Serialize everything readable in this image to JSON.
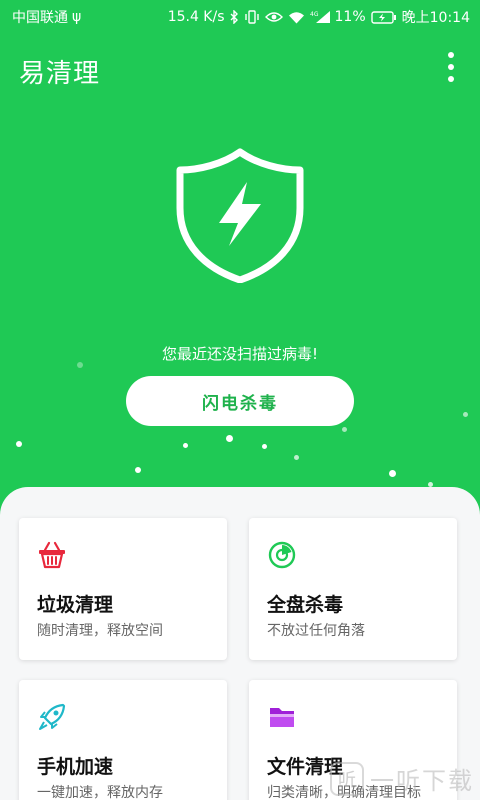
{
  "status": {
    "carrier": "中国联通",
    "usb_glyph": "ψ",
    "speed": "15.4 K/s",
    "battery": "11%",
    "time": "晚上10:14",
    "signal_tag": "4G",
    "icons": [
      "usb-icon",
      "bluetooth-icon",
      "vibrate-icon",
      "eye-icon",
      "wifi-icon",
      "signal-icon",
      "battery-icon"
    ]
  },
  "app": {
    "title": "易清理"
  },
  "hero": {
    "message": "您最近还没扫描过病毒!",
    "button_label": "闪电杀毒",
    "background_color": "#1fc955",
    "icon": "shield-lightning-icon"
  },
  "cards": [
    {
      "title": "垃圾清理",
      "subtitle": "随时清理，释放空间",
      "icon": "basket-icon",
      "icon_color": "#e8283c"
    },
    {
      "title": "全盘杀毒",
      "subtitle": "不放过任何角落",
      "icon": "radar-icon",
      "icon_color": "#1fc955"
    },
    {
      "title": "手机加速",
      "subtitle": "一键加速，释放内存",
      "icon": "rocket-icon",
      "icon_color": "#1fb8c9"
    },
    {
      "title": "文件清理",
      "subtitle": "归类清晰，明确清理目标",
      "icon": "folder-icon",
      "icon_color": "#a020d8"
    }
  ],
  "watermark": {
    "logo_char": "听",
    "text": "一听下载"
  }
}
